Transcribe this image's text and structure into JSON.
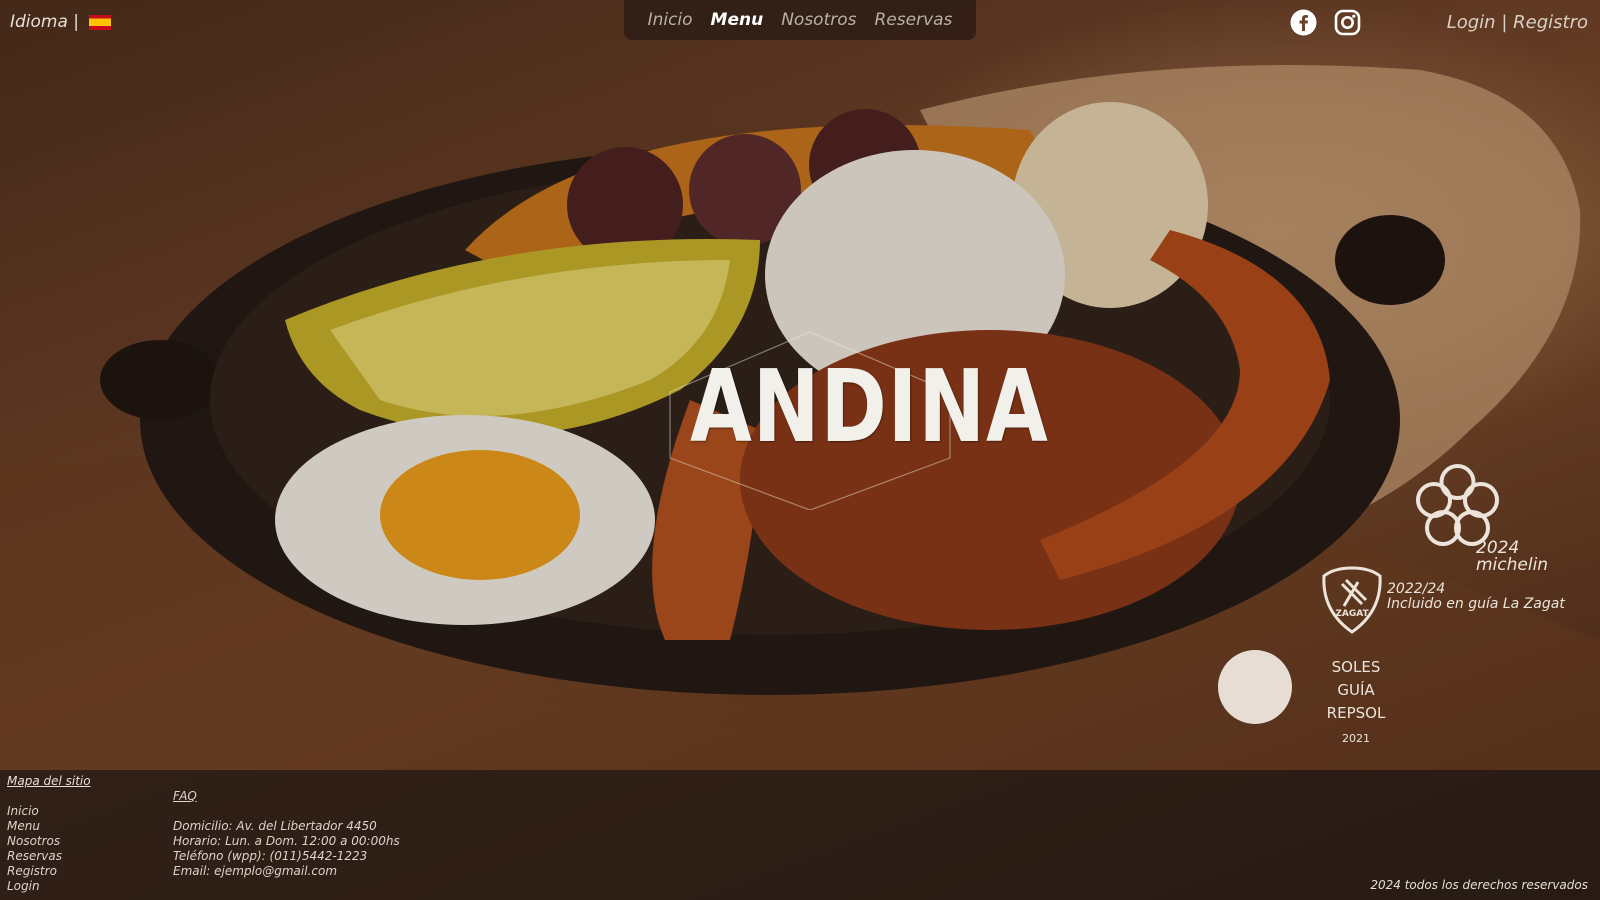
{
  "header": {
    "language_label": "Idioma |",
    "nav": [
      {
        "label": "Inicio",
        "active": false
      },
      {
        "label": "Menu",
        "active": true
      },
      {
        "label": "Nosotros",
        "active": false
      },
      {
        "label": "Reservas",
        "active": false
      }
    ],
    "social_icons": [
      "facebook-icon",
      "instagram-icon"
    ],
    "login_label": "Login",
    "separator": "|",
    "register_label": "Registro"
  },
  "hero": {
    "logo_text": "ANDINA"
  },
  "awards": {
    "michelin": {
      "year": "2024",
      "label": "michelin"
    },
    "zagat": {
      "badge": "ZAGAT",
      "years": "2022/24",
      "text": "Incluido en guía La Zagat"
    },
    "repsol": {
      "line1": "SOLES",
      "line2": "GUÍA REPSOL",
      "year": "2021"
    }
  },
  "footer": {
    "sitemap_title": "Mapa del sitio",
    "sitemap_links": [
      "Inicio",
      "Menu",
      "Nosotros",
      "Reservas",
      "Registro",
      "Login"
    ],
    "faq_label": "FAQ",
    "address": "Domicilio: Av. del Libertador 4450",
    "hours": "Horario: Lun. a Dom. 12:00 a 00:00hs",
    "phone": "Teléfono (wpp): (011)5442-1223",
    "email": "Email: ejemplo@gmail.com",
    "copyright": "2024 todos los derechos reservados"
  },
  "colors": {
    "nav_bg": "#2d1c14",
    "footer_bg": "#261a14",
    "text_light": "#e8e2da",
    "flag_red": "#c60b1e",
    "flag_yellow": "#ffc400"
  }
}
